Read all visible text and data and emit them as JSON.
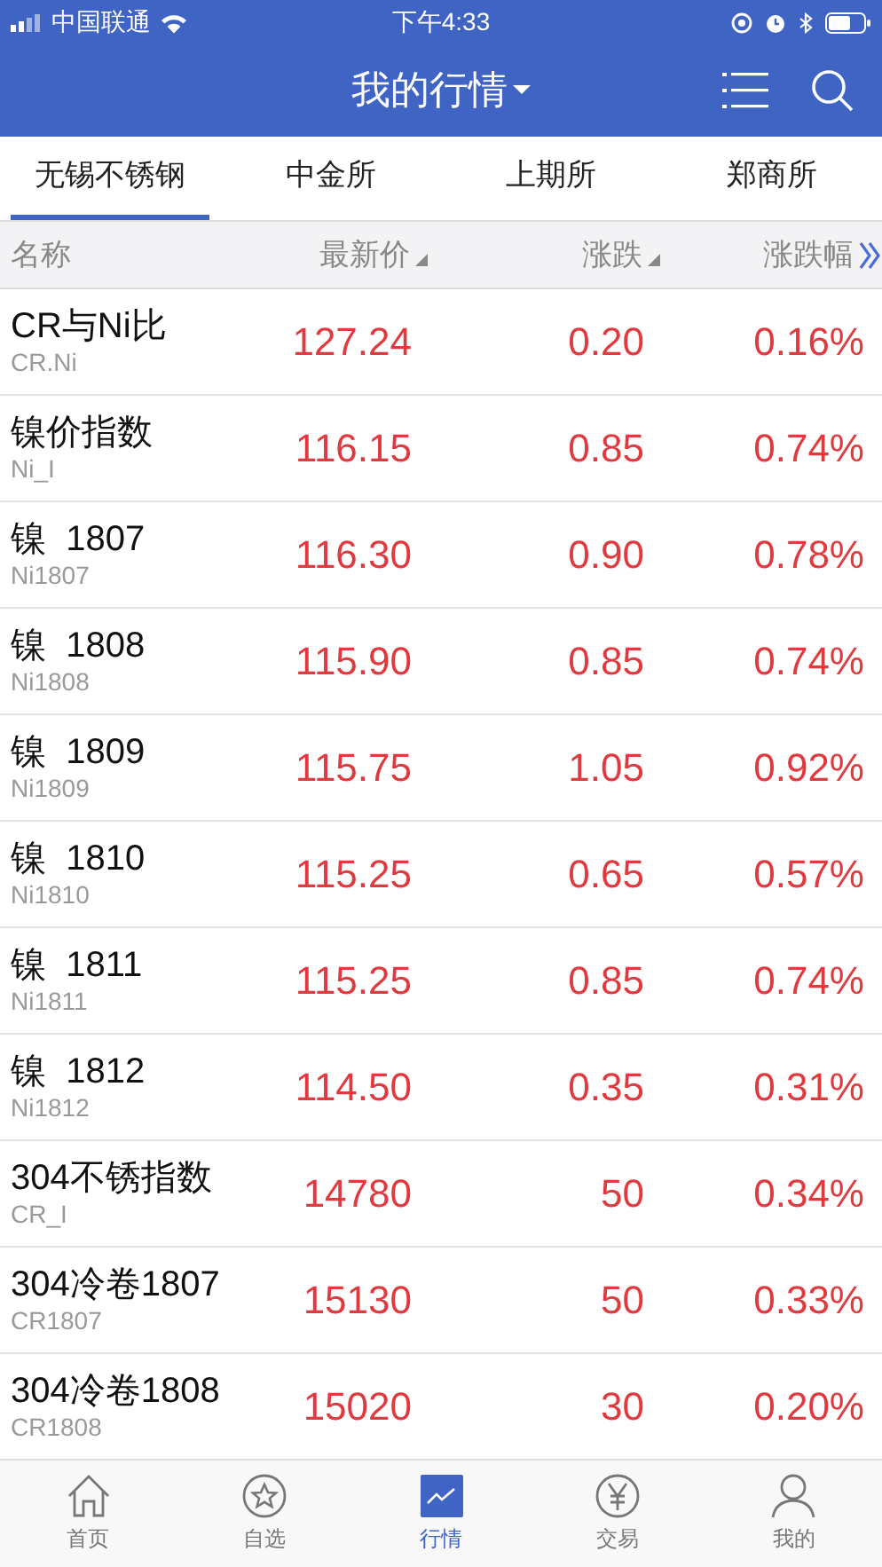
{
  "status_bar": {
    "carrier": "中国联通",
    "time": "下午4:33"
  },
  "nav": {
    "title": "我的行情"
  },
  "tabs": [
    {
      "label": "无锡不锈钢",
      "selected": true
    },
    {
      "label": "中金所",
      "selected": false
    },
    {
      "label": "上期所",
      "selected": false
    },
    {
      "label": "郑商所",
      "selected": false
    }
  ],
  "table": {
    "columns": [
      {
        "label": "名称",
        "kind": "plain"
      },
      {
        "label": "最新价",
        "kind": "sort"
      },
      {
        "label": "涨跌",
        "kind": "sort"
      },
      {
        "label": "涨跌幅",
        "kind": "more"
      }
    ],
    "rows": [
      {
        "name": "CR与Ni比",
        "code": "CR.Ni",
        "price": "127.24",
        "change": "0.20",
        "pct": "0.16%"
      },
      {
        "name": "镍价指数",
        "code": "Ni_I",
        "price": "116.15",
        "change": "0.85",
        "pct": "0.74%"
      },
      {
        "name": "镍  1807",
        "code": "Ni1807",
        "price": "116.30",
        "change": "0.90",
        "pct": "0.78%"
      },
      {
        "name": "镍  1808",
        "code": "Ni1808",
        "price": "115.90",
        "change": "0.85",
        "pct": "0.74%"
      },
      {
        "name": "镍  1809",
        "code": "Ni1809",
        "price": "115.75",
        "change": "1.05",
        "pct": "0.92%"
      },
      {
        "name": "镍  1810",
        "code": "Ni1810",
        "price": "115.25",
        "change": "0.65",
        "pct": "0.57%"
      },
      {
        "name": "镍  1811",
        "code": "Ni1811",
        "price": "115.25",
        "change": "0.85",
        "pct": "0.74%"
      },
      {
        "name": "镍  1812",
        "code": "Ni1812",
        "price": "114.50",
        "change": "0.35",
        "pct": "0.31%"
      },
      {
        "name": "304不锈指数",
        "code": "CR_I",
        "price": "14780",
        "change": "50",
        "pct": "0.34%"
      },
      {
        "name": "304冷卷1807",
        "code": "CR1807",
        "price": "15130",
        "change": "50",
        "pct": "0.33%"
      },
      {
        "name": "304冷卷1808",
        "code": "CR1808",
        "price": "15020",
        "change": "30",
        "pct": "0.20%"
      }
    ]
  },
  "tab_bar": [
    {
      "label": "首页",
      "kind": "home",
      "selected": false
    },
    {
      "label": "自选",
      "kind": "star",
      "selected": false
    },
    {
      "label": "行情",
      "kind": "chart",
      "selected": true
    },
    {
      "label": "交易",
      "kind": "yen",
      "selected": false
    },
    {
      "label": "我的",
      "kind": "person",
      "selected": false
    }
  ]
}
